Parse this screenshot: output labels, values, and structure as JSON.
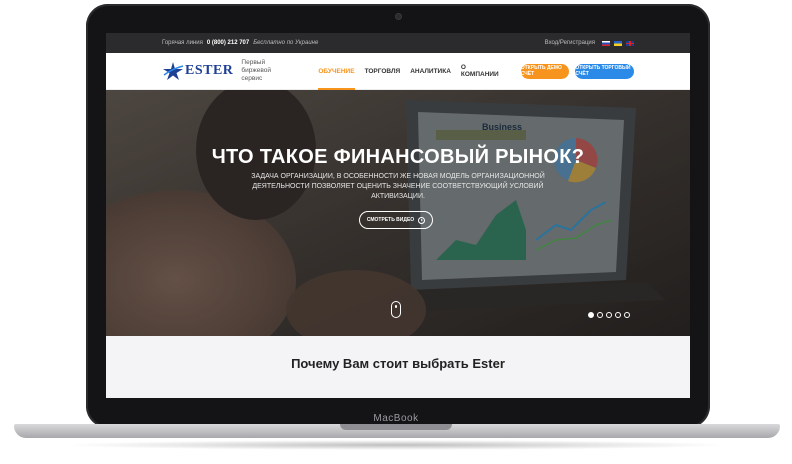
{
  "device": {
    "label": "MacBook"
  },
  "topbar": {
    "hotline_label": "Горячая линия",
    "phone": "0 (800) 212 707",
    "free_text": "Бесплатно по Украине",
    "auth_link": "Вход/Регистрация",
    "languages": [
      "ru",
      "ua",
      "en"
    ]
  },
  "header": {
    "logo_text": "ESTER",
    "tagline": "Первый биржевой сервис",
    "nav": [
      "ОБУЧЕНИЕ",
      "ТОРГОВЛЯ",
      "АНАЛИТИКА",
      "О КОМПАНИИ"
    ],
    "active_nav": "ОБУЧЕНИЕ",
    "demo_button": "ОТКРЫТЬ ДЕМО СЧЁТ",
    "real_button": "ОТКРЫТЬ ТОРГОВЫЙ СЧЁТ"
  },
  "hero": {
    "title": "ЧТО ТАКОЕ ФИНАНСОВЫЙ РЫНОК?",
    "subtitle": "ЗАДАЧА ОРГАНИЗАЦИИ, В ОСОБЕННОСТИ ЖЕ НОВАЯ МОДЕЛЬ ОРГАНИЗАЦИОННОЙ ДЕЯТЕЛЬНОСТИ ПОЗВОЛЯЕТ ОЦЕНИТЬ ЗНАЧЕНИЕ СООТВЕТСТВУЮЩИЙ УСЛОВИЙ АКТИВИЗАЦИИ.",
    "video_button": "СМОТРЕТЬ ВИДЕО",
    "screen_label": "Business",
    "slides_total": 5,
    "slide_active": 1
  },
  "section": {
    "title": "Почему Вам стоит выбрать Ester"
  },
  "colors": {
    "accent_orange": "#f7941d",
    "accent_blue": "#2b8ae8",
    "brand": "#1d3f94"
  }
}
